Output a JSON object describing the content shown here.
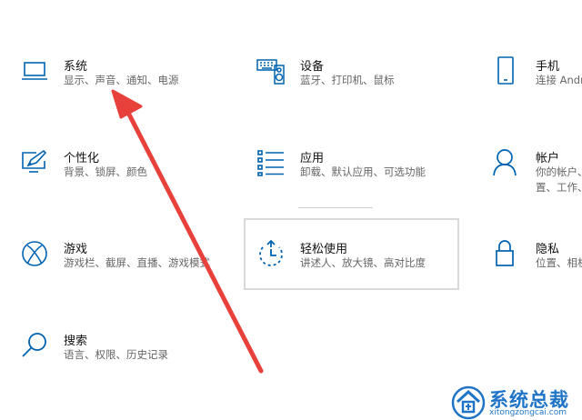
{
  "settings": {
    "col1": [
      {
        "title": "系统",
        "desc": [
          "显示、声音、通知、电源"
        ],
        "icon": "laptop-icon"
      },
      {
        "title": "个性化",
        "desc": [
          "背景、锁屏、颜色"
        ],
        "icon": "personalization-icon"
      },
      {
        "title": "游戏",
        "desc": [
          "游戏栏、截屏、直播、游戏模式"
        ],
        "icon": "xbox-icon"
      },
      {
        "title": "搜索",
        "desc": [
          "语言、权限、历史记录"
        ],
        "icon": "search-icon"
      }
    ],
    "col2": [
      {
        "title": "设备",
        "desc": [
          "蓝牙、打印机、鼠标"
        ],
        "icon": "devices-icon"
      },
      {
        "title": "应用",
        "desc": [
          "卸载、默认应用、可选功能"
        ],
        "icon": "apps-icon"
      },
      {
        "title": "轻松使用",
        "desc": [
          "讲述人、放大镜、高对比度"
        ],
        "icon": "ease-of-access-icon"
      }
    ],
    "col3": [
      {
        "title": "手机",
        "desc": [
          "连接 Andr"
        ],
        "icon": "phone-icon"
      },
      {
        "title": "帐户",
        "desc": [
          "你的帐户、",
          "置、工作、"
        ],
        "icon": "account-icon"
      },
      {
        "title": "隐私",
        "desc": [
          "位置、相机"
        ],
        "icon": "lock-icon"
      }
    ]
  },
  "colors": {
    "accent": "#0063b1",
    "arrow": "#e8403a",
    "watermark": "#1f74c7"
  },
  "watermark": {
    "title": "系统总裁",
    "url": "xitongzongcai.com"
  }
}
